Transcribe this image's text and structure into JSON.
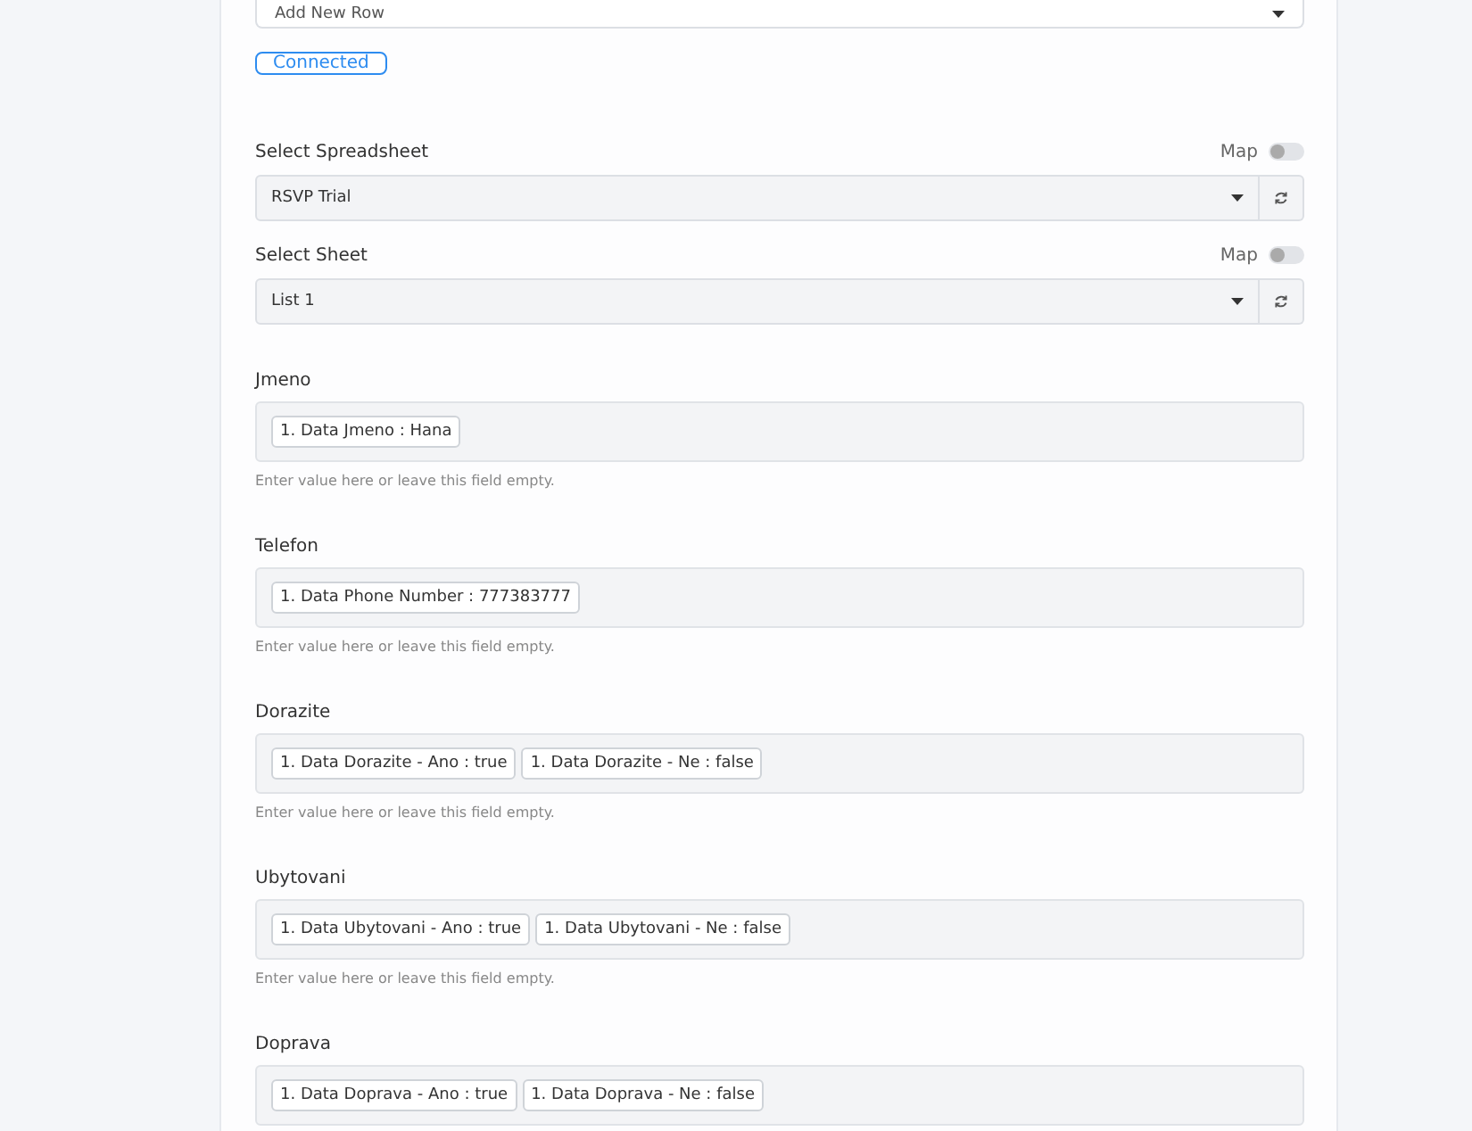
{
  "action": {
    "value": "Add New Row"
  },
  "connect_button": {
    "label": "Connected"
  },
  "selects": [
    {
      "label": "Select Spreadsheet",
      "map_label": "Map",
      "map_on": false,
      "value": "RSVP Trial"
    },
    {
      "label": "Select Sheet",
      "map_label": "Map",
      "map_on": false,
      "value": "List 1"
    }
  ],
  "fields": [
    {
      "label": "Jmeno",
      "tokens": [
        "1. Data Jmeno : Hana"
      ],
      "help": "Enter value here or leave this field empty."
    },
    {
      "label": "Telefon",
      "tokens": [
        "1. Data Phone Number : 777383777"
      ],
      "help": "Enter value here or leave this field empty."
    },
    {
      "label": "Dorazite",
      "tokens": [
        "1. Data Dorazite - Ano : true",
        "1. Data Dorazite - Ne : false"
      ],
      "help": "Enter value here or leave this field empty."
    },
    {
      "label": "Ubytovani",
      "tokens": [
        "1. Data Ubytovani - Ano : true",
        "1. Data Ubytovani - Ne : false"
      ],
      "help": "Enter value here or leave this field empty."
    },
    {
      "label": "Doprava",
      "tokens": [
        "1. Data Doprava - Ano : true",
        "1. Data Doprava - Ne : false"
      ]
    }
  ]
}
